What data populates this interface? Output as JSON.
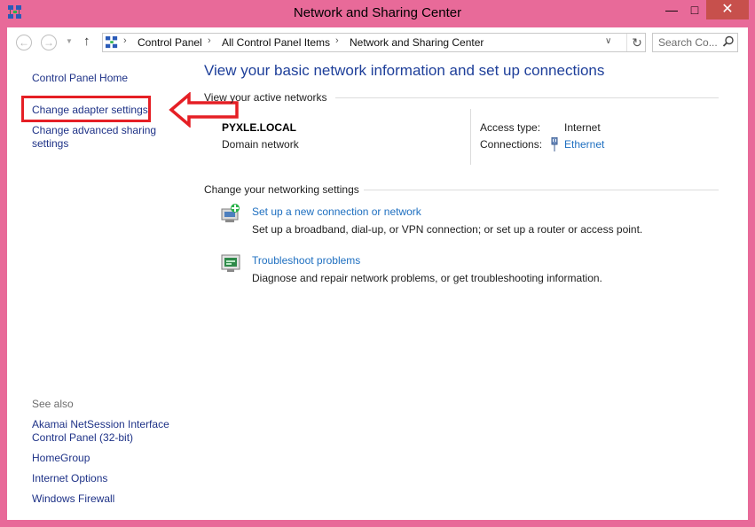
{
  "window": {
    "title": "Network and Sharing Center",
    "controls": {
      "minimize": "—",
      "maximize": "□",
      "close": "✕"
    }
  },
  "toolbar": {
    "back": "←",
    "forward": "→",
    "recent": "▼",
    "up": "↑",
    "breadcrumb": [
      "Control Panel",
      "All Control Panel Items",
      "Network and Sharing Center"
    ],
    "separator": "›",
    "dropdown": "∨",
    "refresh": "↻",
    "search_placeholder": "Search Co..."
  },
  "sidebar": {
    "home": "Control Panel Home",
    "adapter": "Change adapter settings",
    "advanced": "Change advanced sharing settings",
    "see_also_heading": "See also",
    "see_also": [
      "Akamai NetSession Interface Control Panel (32-bit)",
      "HomeGroup",
      "Internet Options",
      "Windows Firewall"
    ]
  },
  "annotation": {
    "box_color": "#e51f25",
    "arrow_color": "#e51f25"
  },
  "main": {
    "title": "View your basic network information and set up connections",
    "active_networks_heading": "View your active networks",
    "network": {
      "name": "PYXLE.LOCAL",
      "type": "Domain network",
      "access_type_label": "Access type:",
      "access_type_value": "Internet",
      "connections_label": "Connections:",
      "connections_value": "Ethernet"
    },
    "settings_heading": "Change your networking settings",
    "tasks": [
      {
        "link": "Set up a new connection or network",
        "desc": "Set up a broadband, dial-up, or VPN connection; or set up a router or access point."
      },
      {
        "link": "Troubleshoot problems",
        "desc": "Diagnose and repair network problems, or get troubleshooting information."
      }
    ]
  },
  "colors": {
    "frame": "#e86a99",
    "close_button": "#c7504c",
    "link": "#1e3287",
    "task_link": "#1e6fc0",
    "heading": "#1e3f9a"
  },
  "icons": [
    "network-center-icon",
    "search-icon",
    "ethernet-icon",
    "new-connection-icon",
    "troubleshoot-icon"
  ]
}
